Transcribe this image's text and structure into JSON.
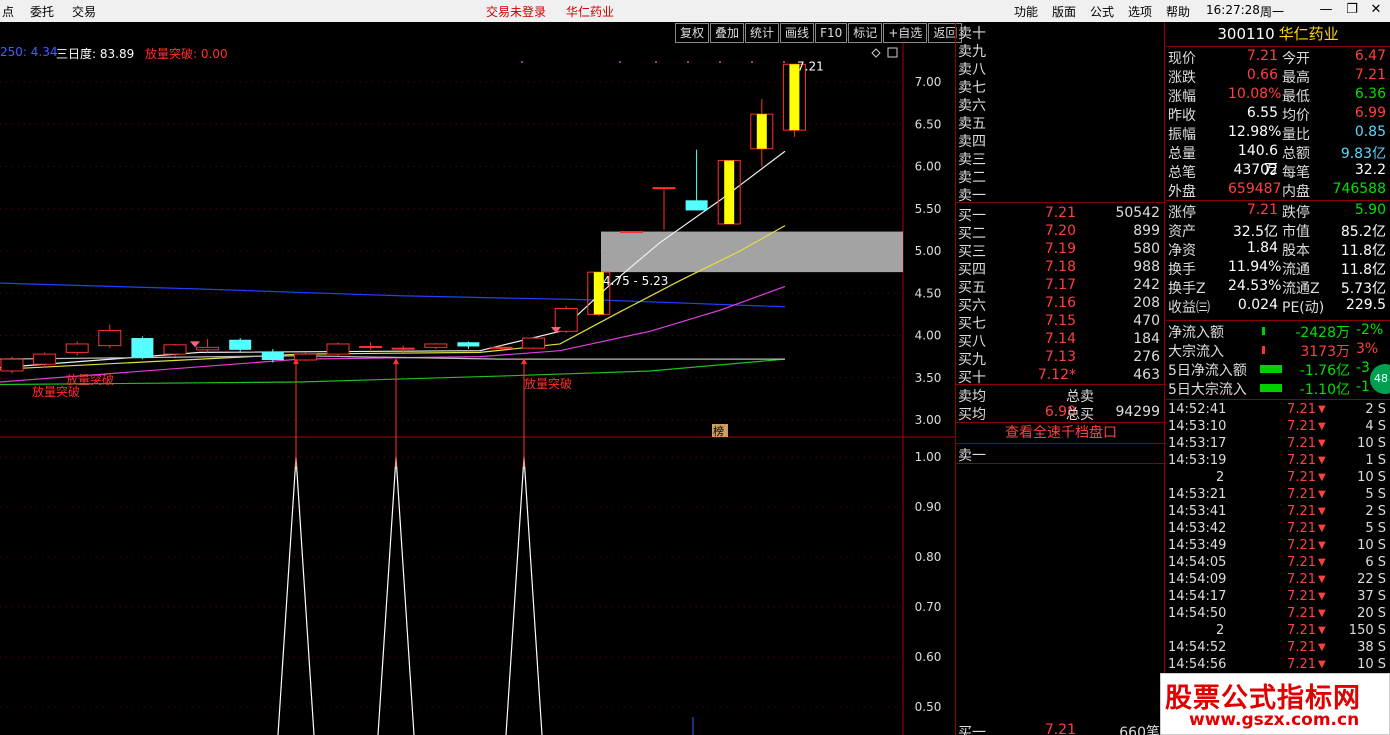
{
  "menu": {
    "left": [
      "点",
      "委托",
      "交易"
    ],
    "status": "交易未登录",
    "stock_title": "华仁药业",
    "right": [
      "功能",
      "版面",
      "公式",
      "选项",
      "帮助"
    ],
    "time": "16:27:28",
    "weekday": "周一",
    "win_min": "—",
    "win_restore": "❐",
    "win_close": "✕"
  },
  "toolbar": [
    "复权",
    "叠加",
    "统计",
    "画线",
    "F10",
    "标记",
    "+自选",
    "返回"
  ],
  "indicators": {
    "ma_label": "250: 4.34",
    "sanri": "三日度: 83.89",
    "fangliang": "放量突破: 0.00"
  },
  "chart_data": {
    "type": "candlestick",
    "price_axis": [
      "7.00",
      "6.50",
      "6.00",
      "5.50",
      "5.00",
      "4.50",
      "4.00",
      "3.50",
      "3.00"
    ],
    "volume_axis": [
      "1.00",
      "0.90",
      "0.80",
      "0.70",
      "0.60",
      "0.50"
    ],
    "candles": [
      {
        "o": 3.58,
        "c": 3.72,
        "h": 3.75,
        "l": 3.55
      },
      {
        "o": 3.66,
        "c": 3.78,
        "h": 3.8,
        "l": 3.62
      },
      {
        "o": 3.8,
        "c": 3.9,
        "h": 3.93,
        "l": 3.76
      },
      {
        "o": 3.88,
        "c": 4.06,
        "h": 4.13,
        "l": 3.85
      },
      {
        "o": 3.97,
        "c": 3.74,
        "h": 3.99,
        "l": 3.72
      },
      {
        "o": 3.78,
        "c": 3.89,
        "h": 3.9,
        "l": 3.75
      },
      {
        "o": 3.83,
        "c": 3.86,
        "h": 3.96,
        "l": 3.8
      },
      {
        "o": 3.95,
        "c": 3.83,
        "h": 3.97,
        "l": 3.81
      },
      {
        "o": 3.81,
        "c": 3.71,
        "h": 3.84,
        "l": 3.68
      },
      {
        "o": 3.71,
        "c": 3.78,
        "h": 3.8,
        "l": 3.7
      },
      {
        "o": 3.78,
        "c": 3.9,
        "h": 3.92,
        "l": 3.76
      },
      {
        "o": 3.87,
        "c": 3.87,
        "h": 3.92,
        "l": 3.83
      },
      {
        "o": 3.85,
        "c": 3.85,
        "h": 3.88,
        "l": 3.8
      },
      {
        "o": 3.86,
        "c": 3.9,
        "h": 3.91,
        "l": 3.84
      },
      {
        "o": 3.92,
        "c": 3.87,
        "h": 3.93,
        "l": 3.84
      },
      {
        "o": 3.86,
        "c": 3.86,
        "h": 3.88,
        "l": 3.83
      },
      {
        "o": 3.85,
        "c": 3.97,
        "h": 3.98,
        "l": 3.84
      },
      {
        "o": 4.05,
        "c": 4.32,
        "h": 4.35,
        "l": 4.03
      },
      {
        "o": 4.25,
        "c": 4.75,
        "h": 4.75,
        "l": 4.23
      },
      {
        "o": 5.23,
        "c": 5.23,
        "h": 5.23,
        "l": 5.23
      },
      {
        "o": 5.75,
        "c": 5.75,
        "h": 5.75,
        "l": 5.25
      },
      {
        "o": 5.6,
        "c": 5.48,
        "h": 6.2,
        "l": 5.48
      },
      {
        "o": 5.32,
        "c": 6.07,
        "h": 6.07,
        "l": 5.32
      },
      {
        "o": 6.21,
        "c": 6.62,
        "h": 6.8,
        "l": 6.0
      },
      {
        "o": 6.43,
        "c": 7.21,
        "h": 7.21,
        "l": 6.35
      }
    ],
    "annotations": {
      "range_label": "4.75 - 5.23",
      "peak_label": "7.21",
      "breakout_label": "放量突破",
      "rank_label": "榜"
    }
  },
  "orderbook": {
    "sell": [
      {
        "label": "卖十"
      },
      {
        "label": "卖九"
      },
      {
        "label": "卖八"
      },
      {
        "label": "卖七"
      },
      {
        "label": "卖六"
      },
      {
        "label": "卖五"
      },
      {
        "label": "卖四"
      },
      {
        "label": "卖三"
      },
      {
        "label": "卖二"
      },
      {
        "label": "卖一"
      }
    ],
    "buy": [
      {
        "label": "买一",
        "price": "7.21",
        "vol": "50542"
      },
      {
        "label": "买二",
        "price": "7.20",
        "vol": "899"
      },
      {
        "label": "买三",
        "price": "7.19",
        "vol": "580"
      },
      {
        "label": "买四",
        "price": "7.18",
        "vol": "988"
      },
      {
        "label": "买五",
        "price": "7.17",
        "vol": "242"
      },
      {
        "label": "买六",
        "price": "7.16",
        "vol": "208"
      },
      {
        "label": "买七",
        "price": "7.15",
        "vol": "470"
      },
      {
        "label": "买八",
        "price": "7.14",
        "vol": "184"
      },
      {
        "label": "买九",
        "price": "7.13",
        "vol": "276"
      },
      {
        "label": "买十",
        "price": "7.12*",
        "vol": "463"
      }
    ],
    "avg_sell_label": "卖均",
    "total_sell_label": "总卖",
    "avg_buy_label": "买均",
    "avg_buy": "6.98",
    "total_buy_label": "总买",
    "total_buy": "94299",
    "button": "查看全速千档盘口",
    "bottom_sell1": "卖一",
    "bottom_buy1": "买一",
    "bottom_buy1_price": "7.21",
    "bottom_buy1_vol": "660笔"
  },
  "quote": {
    "code": "300110",
    "name": "华仁药业",
    "rows": [
      {
        "l1": "现价",
        "v1": "7.21",
        "c1": "red",
        "l2": "今开",
        "v2": "6.47",
        "c2": "red"
      },
      {
        "l1": "涨跌",
        "v1": "0.66",
        "c1": "red",
        "l2": "最高",
        "v2": "7.21",
        "c2": "red"
      },
      {
        "l1": "涨幅",
        "v1": "10.08%",
        "c1": "red",
        "l2": "最低",
        "v2": "6.36",
        "c2": "green"
      },
      {
        "l1": "昨收",
        "v1": "6.55",
        "c1": "white",
        "l2": "均价",
        "v2": "6.99",
        "c2": "red"
      },
      {
        "l1": "振幅",
        "v1": "12.98%",
        "c1": "white",
        "l2": "量比",
        "v2": "0.85",
        "c2": "cyan"
      },
      {
        "l1": "总量",
        "v1": "140.6万",
        "c1": "white",
        "l2": "总额",
        "v2": "9.83亿",
        "c2": "cyan"
      },
      {
        "l1": "总笔",
        "v1": "43702",
        "c1": "white",
        "l2": "每笔",
        "v2": "32.2",
        "c2": "white"
      },
      {
        "l1": "外盘",
        "v1": "659487",
        "c1": "red",
        "l2": "内盘",
        "v2": "746588",
        "c2": "green"
      },
      {
        "l1": "涨停",
        "v1": "7.21",
        "c1": "red",
        "l2": "跌停",
        "v2": "5.90",
        "c2": "green"
      },
      {
        "l1": "资产",
        "v1": "32.5亿",
        "c1": "white",
        "l2": "市值",
        "v2": "85.2亿",
        "c2": "white"
      },
      {
        "l1": "净资",
        "v1": "1.84",
        "c1": "white",
        "l2": "股本",
        "v2": "11.8亿",
        "c2": "white"
      },
      {
        "l1": "换手",
        "v1": "11.94%",
        "c1": "white",
        "l2": "流通",
        "v2": "11.8亿",
        "c2": "white"
      },
      {
        "l1": "换手Z",
        "v1": "24.53%",
        "c1": "white",
        "l2": "流通Z",
        "v2": "5.73亿",
        "c2": "white"
      },
      {
        "l1": "收益㈢",
        "v1": "0.024",
        "c1": "white",
        "l2": "PE(动)",
        "v2": "229.5",
        "c2": "white"
      }
    ],
    "flows": [
      {
        "label": "净流入额",
        "value": "-2428万",
        "pct": "-2%",
        "vcolor": "green",
        "pcolor": "green"
      },
      {
        "label": "大宗流入",
        "value": "3173万",
        "pct": "3%",
        "vcolor": "red",
        "pcolor": "red"
      },
      {
        "label": "5日净流入额",
        "value": "-1.76亿",
        "pct": "-3",
        "vcolor": "green",
        "pcolor": "green"
      },
      {
        "label": "5日大宗流入",
        "value": "-1.10亿",
        "pct": "-1",
        "vcolor": "green",
        "pcolor": "green"
      }
    ],
    "float_badge": "48"
  },
  "ticks": [
    {
      "time": "14:52:41",
      "price": "7.21",
      "vol": "2 S"
    },
    {
      "time": "14:53:10",
      "price": "7.21",
      "vol": "4 S"
    },
    {
      "time": "14:53:17",
      "price": "7.21",
      "vol": "10 S"
    },
    {
      "time": "14:53:19",
      "price": "7.21",
      "vol": "1 S"
    },
    {
      "time": "2",
      "price": "7.21",
      "vol": "10 S"
    },
    {
      "time": "14:53:21",
      "price": "7.21",
      "vol": "5 S"
    },
    {
      "time": "14:53:41",
      "price": "7.21",
      "vol": "2 S"
    },
    {
      "time": "14:53:42",
      "price": "7.21",
      "vol": "5 S"
    },
    {
      "time": "14:53:49",
      "price": "7.21",
      "vol": "10 S"
    },
    {
      "time": "14:54:05",
      "price": "7.21",
      "vol": "6 S"
    },
    {
      "time": "14:54:09",
      "price": "7.21",
      "vol": "22 S"
    },
    {
      "time": "14:54:17",
      "price": "7.21",
      "vol": "37 S"
    },
    {
      "time": "14:54:50",
      "price": "7.21",
      "vol": "20 S"
    },
    {
      "time": "2",
      "price": "7.21",
      "vol": "150 S"
    },
    {
      "time": "14:54:52",
      "price": "7.21",
      "vol": "38 S"
    },
    {
      "time": "14:54:56",
      "price": "7.21",
      "vol": "10 S"
    }
  ],
  "watermark": {
    "line1": "股票公式指标网",
    "line2": "www.gszx.com.cn"
  }
}
